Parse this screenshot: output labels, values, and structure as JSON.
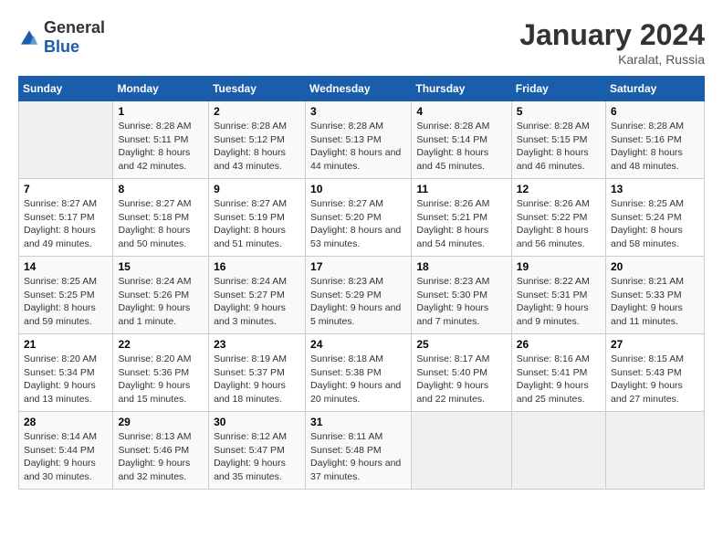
{
  "header": {
    "logo_general": "General",
    "logo_blue": "Blue",
    "title": "January 2024",
    "subtitle": "Karalat, Russia"
  },
  "weekdays": [
    "Sunday",
    "Monday",
    "Tuesday",
    "Wednesday",
    "Thursday",
    "Friday",
    "Saturday"
  ],
  "weeks": [
    [
      {
        "day": "",
        "sunrise": "",
        "sunset": "",
        "daylight": ""
      },
      {
        "day": "1",
        "sunrise": "Sunrise: 8:28 AM",
        "sunset": "Sunset: 5:11 PM",
        "daylight": "Daylight: 8 hours and 42 minutes."
      },
      {
        "day": "2",
        "sunrise": "Sunrise: 8:28 AM",
        "sunset": "Sunset: 5:12 PM",
        "daylight": "Daylight: 8 hours and 43 minutes."
      },
      {
        "day": "3",
        "sunrise": "Sunrise: 8:28 AM",
        "sunset": "Sunset: 5:13 PM",
        "daylight": "Daylight: 8 hours and 44 minutes."
      },
      {
        "day": "4",
        "sunrise": "Sunrise: 8:28 AM",
        "sunset": "Sunset: 5:14 PM",
        "daylight": "Daylight: 8 hours and 45 minutes."
      },
      {
        "day": "5",
        "sunrise": "Sunrise: 8:28 AM",
        "sunset": "Sunset: 5:15 PM",
        "daylight": "Daylight: 8 hours and 46 minutes."
      },
      {
        "day": "6",
        "sunrise": "Sunrise: 8:28 AM",
        "sunset": "Sunset: 5:16 PM",
        "daylight": "Daylight: 8 hours and 48 minutes."
      }
    ],
    [
      {
        "day": "7",
        "sunrise": "Sunrise: 8:27 AM",
        "sunset": "Sunset: 5:17 PM",
        "daylight": "Daylight: 8 hours and 49 minutes."
      },
      {
        "day": "8",
        "sunrise": "Sunrise: 8:27 AM",
        "sunset": "Sunset: 5:18 PM",
        "daylight": "Daylight: 8 hours and 50 minutes."
      },
      {
        "day": "9",
        "sunrise": "Sunrise: 8:27 AM",
        "sunset": "Sunset: 5:19 PM",
        "daylight": "Daylight: 8 hours and 51 minutes."
      },
      {
        "day": "10",
        "sunrise": "Sunrise: 8:27 AM",
        "sunset": "Sunset: 5:20 PM",
        "daylight": "Daylight: 8 hours and 53 minutes."
      },
      {
        "day": "11",
        "sunrise": "Sunrise: 8:26 AM",
        "sunset": "Sunset: 5:21 PM",
        "daylight": "Daylight: 8 hours and 54 minutes."
      },
      {
        "day": "12",
        "sunrise": "Sunrise: 8:26 AM",
        "sunset": "Sunset: 5:22 PM",
        "daylight": "Daylight: 8 hours and 56 minutes."
      },
      {
        "day": "13",
        "sunrise": "Sunrise: 8:25 AM",
        "sunset": "Sunset: 5:24 PM",
        "daylight": "Daylight: 8 hours and 58 minutes."
      }
    ],
    [
      {
        "day": "14",
        "sunrise": "Sunrise: 8:25 AM",
        "sunset": "Sunset: 5:25 PM",
        "daylight": "Daylight: 8 hours and 59 minutes."
      },
      {
        "day": "15",
        "sunrise": "Sunrise: 8:24 AM",
        "sunset": "Sunset: 5:26 PM",
        "daylight": "Daylight: 9 hours and 1 minute."
      },
      {
        "day": "16",
        "sunrise": "Sunrise: 8:24 AM",
        "sunset": "Sunset: 5:27 PM",
        "daylight": "Daylight: 9 hours and 3 minutes."
      },
      {
        "day": "17",
        "sunrise": "Sunrise: 8:23 AM",
        "sunset": "Sunset: 5:29 PM",
        "daylight": "Daylight: 9 hours and 5 minutes."
      },
      {
        "day": "18",
        "sunrise": "Sunrise: 8:23 AM",
        "sunset": "Sunset: 5:30 PM",
        "daylight": "Daylight: 9 hours and 7 minutes."
      },
      {
        "day": "19",
        "sunrise": "Sunrise: 8:22 AM",
        "sunset": "Sunset: 5:31 PM",
        "daylight": "Daylight: 9 hours and 9 minutes."
      },
      {
        "day": "20",
        "sunrise": "Sunrise: 8:21 AM",
        "sunset": "Sunset: 5:33 PM",
        "daylight": "Daylight: 9 hours and 11 minutes."
      }
    ],
    [
      {
        "day": "21",
        "sunrise": "Sunrise: 8:20 AM",
        "sunset": "Sunset: 5:34 PM",
        "daylight": "Daylight: 9 hours and 13 minutes."
      },
      {
        "day": "22",
        "sunrise": "Sunrise: 8:20 AM",
        "sunset": "Sunset: 5:36 PM",
        "daylight": "Daylight: 9 hours and 15 minutes."
      },
      {
        "day": "23",
        "sunrise": "Sunrise: 8:19 AM",
        "sunset": "Sunset: 5:37 PM",
        "daylight": "Daylight: 9 hours and 18 minutes."
      },
      {
        "day": "24",
        "sunrise": "Sunrise: 8:18 AM",
        "sunset": "Sunset: 5:38 PM",
        "daylight": "Daylight: 9 hours and 20 minutes."
      },
      {
        "day": "25",
        "sunrise": "Sunrise: 8:17 AM",
        "sunset": "Sunset: 5:40 PM",
        "daylight": "Daylight: 9 hours and 22 minutes."
      },
      {
        "day": "26",
        "sunrise": "Sunrise: 8:16 AM",
        "sunset": "Sunset: 5:41 PM",
        "daylight": "Daylight: 9 hours and 25 minutes."
      },
      {
        "day": "27",
        "sunrise": "Sunrise: 8:15 AM",
        "sunset": "Sunset: 5:43 PM",
        "daylight": "Daylight: 9 hours and 27 minutes."
      }
    ],
    [
      {
        "day": "28",
        "sunrise": "Sunrise: 8:14 AM",
        "sunset": "Sunset: 5:44 PM",
        "daylight": "Daylight: 9 hours and 30 minutes."
      },
      {
        "day": "29",
        "sunrise": "Sunrise: 8:13 AM",
        "sunset": "Sunset: 5:46 PM",
        "daylight": "Daylight: 9 hours and 32 minutes."
      },
      {
        "day": "30",
        "sunrise": "Sunrise: 8:12 AM",
        "sunset": "Sunset: 5:47 PM",
        "daylight": "Daylight: 9 hours and 35 minutes."
      },
      {
        "day": "31",
        "sunrise": "Sunrise: 8:11 AM",
        "sunset": "Sunset: 5:48 PM",
        "daylight": "Daylight: 9 hours and 37 minutes."
      },
      {
        "day": "",
        "sunrise": "",
        "sunset": "",
        "daylight": ""
      },
      {
        "day": "",
        "sunrise": "",
        "sunset": "",
        "daylight": ""
      },
      {
        "day": "",
        "sunrise": "",
        "sunset": "",
        "daylight": ""
      }
    ]
  ]
}
